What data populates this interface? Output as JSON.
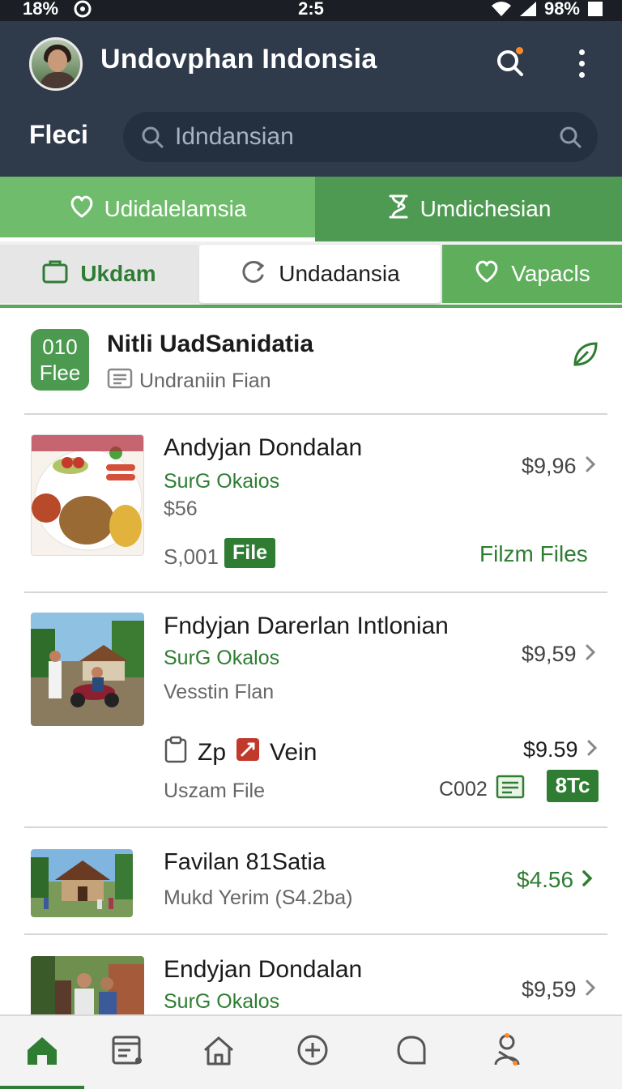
{
  "status_bar": {
    "battery_left": "18%",
    "time": "2:5",
    "battery_right": "98%"
  },
  "header": {
    "title": "Undovphan Indonsia",
    "filter_label": "Fleci",
    "search_placeholder": "Idndansian"
  },
  "primary_tabs": [
    {
      "label": "Udidalelamsia",
      "icon": "heart-icon",
      "active": true
    },
    {
      "label": "Umdichesian",
      "icon": "hourglass-icon",
      "active": false
    }
  ],
  "secondary_tabs": [
    {
      "label": "Ukdam",
      "icon": "bag-icon"
    },
    {
      "label": "Undadansia",
      "icon": "refresh-icon",
      "selected": true
    },
    {
      "label": "Vapacls",
      "icon": "heart-icon"
    }
  ],
  "summary": {
    "badge_number": "010",
    "badge_label": "Flee",
    "title": "Nitli UadSanidatia",
    "subtitle": "Undraniin Fian"
  },
  "items": [
    {
      "title": "Andyjan Dondalan",
      "subtitle": "SurG Okaios",
      "detail": "$56",
      "price": "$9,96",
      "code": "S,001",
      "file_badge": "File",
      "link": "Filzm Files"
    },
    {
      "title": "Fndyjan Darerlan Intlonian",
      "subtitle": "SurG Okalos",
      "detail": "Vesstin Flan",
      "price": "$9,59",
      "meta_zp": "Zp",
      "meta_vein": "Vein",
      "meta_price": "$9.59",
      "meta_file": "Uszam File",
      "meta_code": "C002",
      "meta_badge": "8Tc"
    },
    {
      "title": "Favilan 81Satia",
      "subtitle": "Mukd Yerim (S4.2ba)",
      "price": "$4.56"
    },
    {
      "title": "Endyjan Dondalan",
      "subtitle": "SurG Okalos",
      "price": "$9,59"
    }
  ],
  "colors": {
    "header_bg": "#2f3a4b",
    "tab_active": "#6fbd6c",
    "tab_inactive": "#4f9a52",
    "accent_green": "#2e7d32",
    "badge_dot": "#ff8a2a"
  }
}
